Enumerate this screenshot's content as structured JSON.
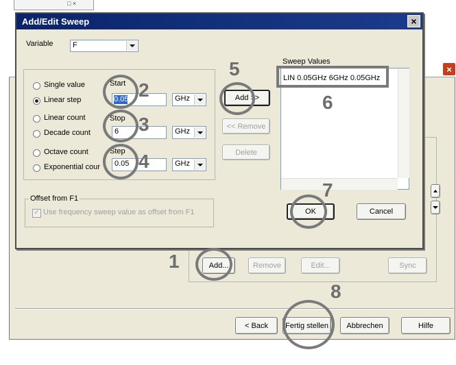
{
  "dialog": {
    "title": "Add/Edit Sweep",
    "variable_label": "Variable",
    "variable_value": "F",
    "sweep_values_label": "Sweep Values",
    "sweep_values": [
      "LIN 0.05GHz 6GHz 0.05GHz"
    ],
    "sweep_types": [
      {
        "label": "Single value",
        "checked": false
      },
      {
        "label": "Linear step",
        "checked": true
      },
      {
        "label": "Linear count",
        "checked": false
      },
      {
        "label": "Decade count",
        "checked": false
      },
      {
        "label": "Octave count",
        "checked": false
      },
      {
        "label": "Exponential cour",
        "checked": false
      }
    ],
    "start_label": "Start",
    "start_value": "0.05",
    "stop_label": "Stop",
    "stop_value": "6",
    "step_label": "Step",
    "step_value": "0.05",
    "unit": "GHz",
    "add_button": "Add >>",
    "remove_button": "<< Remove",
    "delete_button": "Delete",
    "offset_group": "Offset from F1",
    "offset_checkbox": "Use frequency sweep value as offset from F1",
    "ok_button": "OK",
    "cancel_button": "Cancel"
  },
  "wizard": {
    "add_button": "Add...",
    "remove_button": "Remove",
    "edit_button": "Edit...",
    "sync_button": "Sync",
    "back_button": "< Back",
    "finish_button": "Fertig stellen",
    "cancel_button": "Abbrechen",
    "help_button": "Hilfe"
  },
  "annotations": [
    "1",
    "2",
    "3",
    "4",
    "5",
    "6",
    "7",
    "8"
  ],
  "colors": {
    "title_bar": "#0a246a",
    "dialog_bg": "#ece9d8",
    "annotation_gray": "#6e6e6e"
  }
}
